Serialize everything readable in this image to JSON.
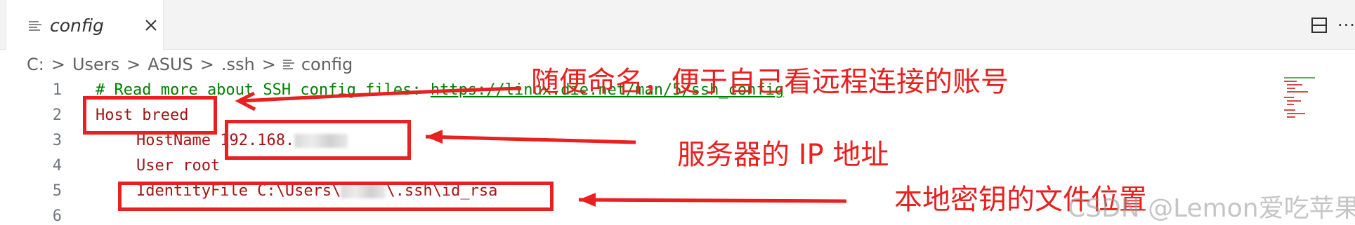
{
  "tab": {
    "label": "config"
  },
  "breadcrumb": [
    "C:",
    "Users",
    "ASUS",
    ".ssh",
    "config"
  ],
  "breadcrumb_sep": ">",
  "more_label": "···",
  "editor": {
    "line_numbers": [
      "1",
      "2",
      "3",
      "4",
      "5",
      "6"
    ],
    "line1": {
      "comment": "# Read more about SSH config files: ",
      "link": "https://linux.die.net/man/5/ssh_config"
    },
    "line2": {
      "text": "Host breed"
    },
    "line3": {
      "key": "HostName ",
      "value_visible": "192.168."
    },
    "line4": {
      "text": "User root"
    },
    "line5": {
      "prefix": "IdentityFile C:\\Users\\",
      "suffix": "\\.ssh\\id_rsa"
    }
  },
  "annotations": {
    "host_note": "随便命名，便于自己看远程连接的账号",
    "ip_note": "服务器的 IP 地址",
    "key_note": "本地密钥的文件位置"
  },
  "watermark": "CSDN @Lemon爱吃苹果",
  "colors": {
    "annotation": "#e8201f",
    "comment": "#008000",
    "keyword": "#a31515"
  }
}
